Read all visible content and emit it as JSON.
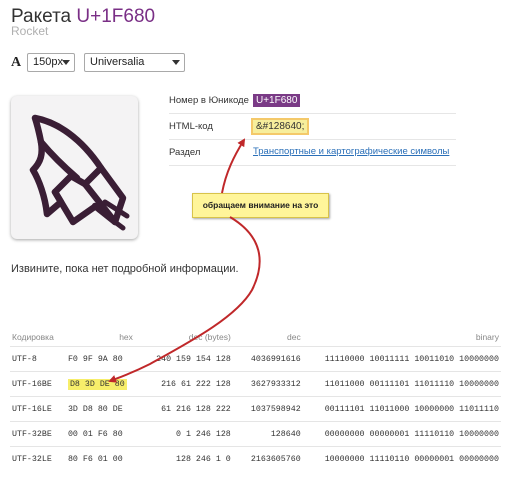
{
  "header": {
    "title_name": "Ракета",
    "title_code": "U+1F680",
    "subtitle": "Rocket"
  },
  "toolbar": {
    "font_icon_label": "A",
    "size_value": "150px",
    "font_value": "Universalia"
  },
  "properties": {
    "unicode_label": "Номер в Юникоде",
    "unicode_value": "U+1F680",
    "html_label": "HTML-код",
    "html_value": "&#128640;",
    "section_label": "Раздел",
    "section_value": "Транспортные и картографические символы"
  },
  "callout": "обращаем внимание на это",
  "no_info": "Извините, пока нет подробной информации.",
  "encodings": {
    "headers": [
      "Кодировка",
      "hex",
      "dec (bytes)",
      "dec",
      "binary"
    ],
    "rows": [
      {
        "name": "UTF-8",
        "hex": "F0 9F 9A 80",
        "dec_bytes": "240 159 154 128",
        "dec": "4036991616",
        "binary": "11110000 10011111 10011010 10000000"
      },
      {
        "name": "UTF-16BE",
        "hex": "D8 3D DE 80",
        "dec_bytes": "216 61 222 128",
        "dec": "3627933312",
        "binary": "11011000 00111101 11011110 10000000"
      },
      {
        "name": "UTF-16LE",
        "hex": "3D D8 80 DE",
        "dec_bytes": "61 216 128 222",
        "dec": "1037598942",
        "binary": "00111101 11011000 10000000 11011110"
      },
      {
        "name": "UTF-32BE",
        "hex": "00 01 F6 80",
        "dec_bytes": "0 1 246 128",
        "dec": "128640",
        "binary": "00000000 00000001 11110110 10000000"
      },
      {
        "name": "UTF-32LE",
        "hex": "80 F6 01 00",
        "dec_bytes": "128 246 1 0",
        "dec": "2163605760",
        "binary": "10000000 11110110 00000001 00000000"
      }
    ]
  },
  "colors": {
    "accent": "#7a2f86",
    "highlight": "#f7ee6a",
    "arrow": "#c0282a"
  }
}
